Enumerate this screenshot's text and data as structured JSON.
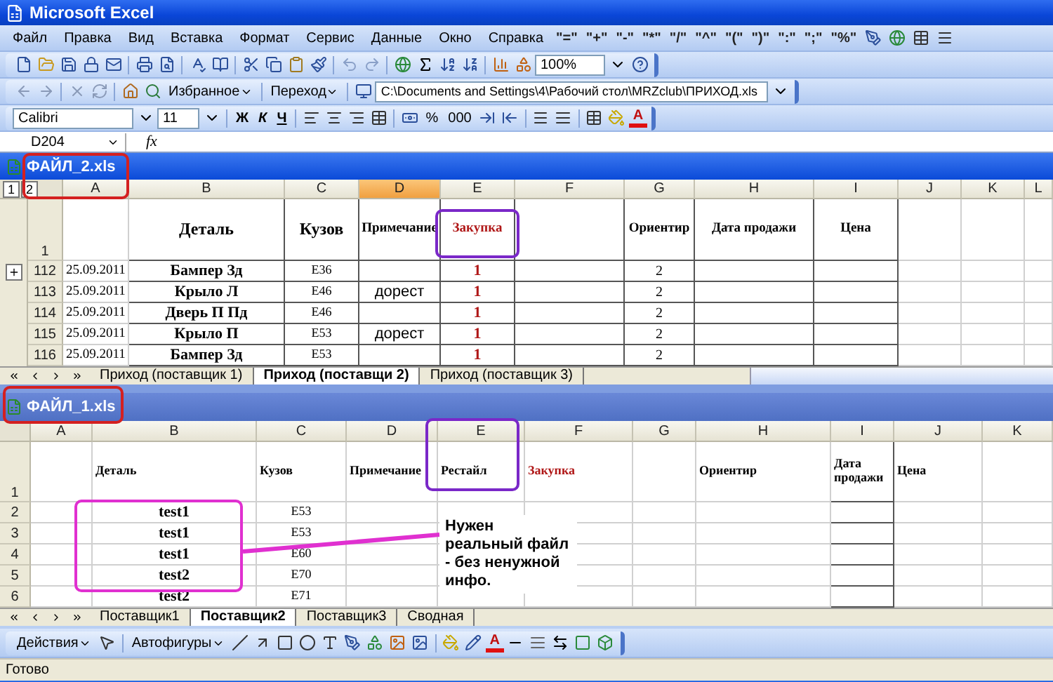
{
  "window": {
    "title": "Microsoft Excel"
  },
  "menu": [
    "Файл",
    "Правка",
    "Вид",
    "Вставка",
    "Формат",
    "Сервис",
    "Данные",
    "Окно",
    "Справка"
  ],
  "operators": [
    "\"=\"",
    "\"+\"",
    "\"-\"",
    "\"*\"",
    "\"/\"",
    "\"^\"",
    "\"(\"",
    "\")\"",
    "\":\"",
    "\";\"",
    "\"%\""
  ],
  "standard_toolbar": {
    "zoom": "100%"
  },
  "web_toolbar": {
    "favorites": "Избранное",
    "go": "Переход",
    "address": "C:\\Documents and Settings\\4\\Рабочий стол\\MRZclub\\ПРИХОД.xls"
  },
  "formatting_toolbar": {
    "font": "Calibri",
    "size": "11",
    "bold": "Ж",
    "italic": "К",
    "underline": "Ч",
    "percent": "%",
    "thousands": "000",
    "font_color": "A"
  },
  "formula_bar": {
    "name_box": "D204",
    "function_label": "fx"
  },
  "workbooks": [
    {
      "title": "ФАЙЛ_2.xls",
      "active": true,
      "outline_levels": [
        "1",
        "2"
      ],
      "columns": [
        {
          "letter": "A",
          "selected": false
        },
        {
          "letter": "B",
          "selected": false
        },
        {
          "letter": "C",
          "selected": false
        },
        {
          "letter": "D",
          "selected": true
        },
        {
          "letter": "E",
          "selected": false
        },
        {
          "letter": "F",
          "selected": false
        },
        {
          "letter": "G",
          "selected": false
        },
        {
          "letter": "H",
          "selected": false
        },
        {
          "letter": "I",
          "selected": false
        },
        {
          "letter": "J",
          "selected": false
        },
        {
          "letter": "K",
          "selected": false
        },
        {
          "letter": "L",
          "selected": false
        }
      ],
      "header_row": {
        "number": "1",
        "cells": [
          "",
          "Деталь",
          "Кузов",
          "Примечание",
          {
            "text": "Закупка",
            "color": "#b01818"
          },
          "",
          "Ориентир",
          "Дата продажи",
          "Цена",
          "",
          "",
          ""
        ]
      },
      "rows": [
        {
          "number": "112",
          "outline_button": true,
          "cells": [
            "25.09.2011",
            "Бампер Зд",
            "E36",
            "",
            "1",
            "",
            "2",
            "",
            "",
            "",
            "",
            ""
          ]
        },
        {
          "number": "113",
          "outline_button": false,
          "cells": [
            "25.09.2011",
            "Крыло Л",
            "E46",
            "дорест",
            "1",
            "",
            "2",
            "",
            "",
            "",
            "",
            ""
          ]
        },
        {
          "number": "114",
          "outline_button": false,
          "cells": [
            "25.09.2011",
            "Дверь П Пд",
            "E46",
            "",
            "1",
            "",
            "2",
            "",
            "",
            "",
            "",
            ""
          ]
        },
        {
          "number": "115",
          "outline_button": false,
          "cells": [
            "25.09.2011",
            "Крыло П",
            "E53",
            "дорест",
            "1",
            "",
            "2",
            "",
            "",
            "",
            "",
            ""
          ]
        },
        {
          "number": "116",
          "outline_button": false,
          "cells": [
            "25.09.2011",
            "Бампер Зд",
            "E53",
            "",
            "1",
            "",
            "2",
            "",
            "",
            "",
            "",
            ""
          ]
        }
      ],
      "sheets": [
        {
          "label": "Приход (поставщик 1)",
          "selected": false
        },
        {
          "label": "Приход (поставщи 2)",
          "selected": true
        },
        {
          "label": "Приход (поставщик 3)",
          "selected": false
        }
      ]
    },
    {
      "title": "ФАЙЛ_1.xls",
      "active": false,
      "columns": [
        {
          "letter": "A",
          "selected": false
        },
        {
          "letter": "B",
          "selected": false
        },
        {
          "letter": "C",
          "selected": false
        },
        {
          "letter": "D",
          "selected": false
        },
        {
          "letter": "E",
          "selected": false
        },
        {
          "letter": "F",
          "selected": false
        },
        {
          "letter": "G",
          "selected": false
        },
        {
          "letter": "H",
          "selected": false
        },
        {
          "letter": "I",
          "selected": false
        },
        {
          "letter": "J",
          "selected": false
        },
        {
          "letter": "K",
          "selected": false
        }
      ],
      "header_row": {
        "number": "1",
        "cells": [
          "",
          "Деталь",
          "Кузов",
          "Примечание",
          "Рестайл",
          {
            "text": "Закупка",
            "color": "#b01818"
          },
          "",
          "Ориентир",
          "Дата продажи",
          "Цена",
          ""
        ]
      },
      "rows": [
        {
          "number": "2",
          "cells": [
            "",
            "test1",
            "E53",
            "",
            "",
            "",
            "",
            "",
            "",
            "",
            ""
          ]
        },
        {
          "number": "3",
          "cells": [
            "",
            "test1",
            "E53",
            "",
            "",
            "",
            "",
            "",
            "",
            "",
            ""
          ]
        },
        {
          "number": "4",
          "cells": [
            "",
            "test1",
            "E60",
            "",
            "",
            "",
            "",
            "",
            "",
            "",
            ""
          ]
        },
        {
          "number": "5",
          "cells": [
            "",
            "test2",
            "E70",
            "",
            "",
            "",
            "",
            "",
            "",
            "",
            ""
          ]
        },
        {
          "number": "6",
          "cells": [
            "",
            "test2",
            "E71",
            "",
            "",
            "",
            "",
            "",
            "",
            "",
            ""
          ]
        }
      ],
      "sheets": [
        {
          "label": "Поставщик1",
          "selected": false
        },
        {
          "label": "Поставщик2",
          "selected": true
        },
        {
          "label": "Поставщик3",
          "selected": false
        },
        {
          "label": "Сводная",
          "selected": false
        }
      ]
    }
  ],
  "annotations": [
    {
      "kind": "frame",
      "color": "#d42020"
    },
    {
      "kind": "frame",
      "color": "#7a28c8"
    },
    {
      "kind": "frame",
      "color": "#d42020"
    },
    {
      "kind": "frame",
      "color": "#7a28c8"
    },
    {
      "kind": "frame",
      "color": "#e030d0"
    },
    {
      "kind": "line",
      "color": "#e030d0"
    },
    {
      "kind": "note",
      "text": "Нужен реальный файл - без ненужной инфо."
    }
  ],
  "drawing_toolbar": {
    "actions": "Действия",
    "autoshapes": "Автофигуры",
    "font_color": "A"
  },
  "status_bar": {
    "text": "Готово"
  }
}
